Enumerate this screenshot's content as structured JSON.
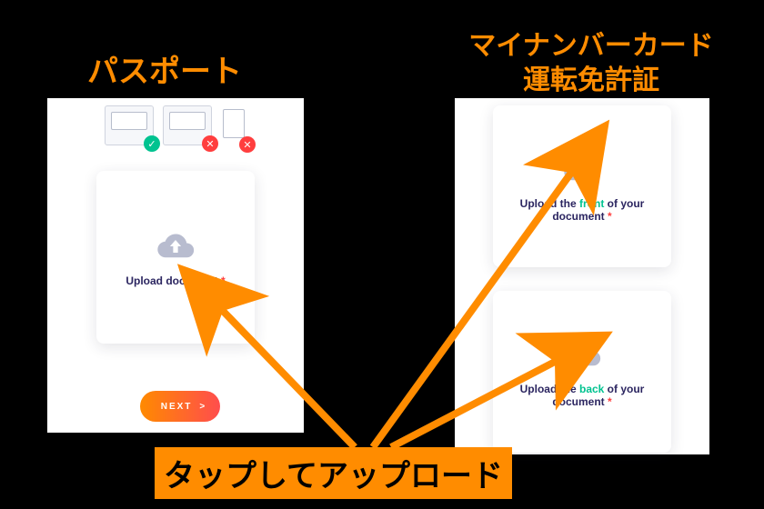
{
  "titles": {
    "left": "パスポート",
    "right_line1": "マイナンバーカード",
    "right_line2": "運転免許証"
  },
  "left_panel": {
    "upload_label": "Upload document ",
    "required_mark": "*",
    "next_label": "NEXT",
    "next_arrow": ">"
  },
  "right_panel": {
    "front_prefix": "Upload the ",
    "front_word": "front",
    "front_suffix": " of your document ",
    "back_prefix": "Upload the ",
    "back_word": "back",
    "back_suffix": " of your document ",
    "required_mark": "*"
  },
  "caption": "タップしてアップロード",
  "icons": {
    "cloud_upload": "cloud-upload-icon",
    "check": "✓",
    "cross": "✕"
  },
  "colors": {
    "brand_orange": "#ff8c00",
    "accent_green": "#00c390",
    "danger_red": "#ff3e3e",
    "text_indigo": "#2b2560"
  }
}
